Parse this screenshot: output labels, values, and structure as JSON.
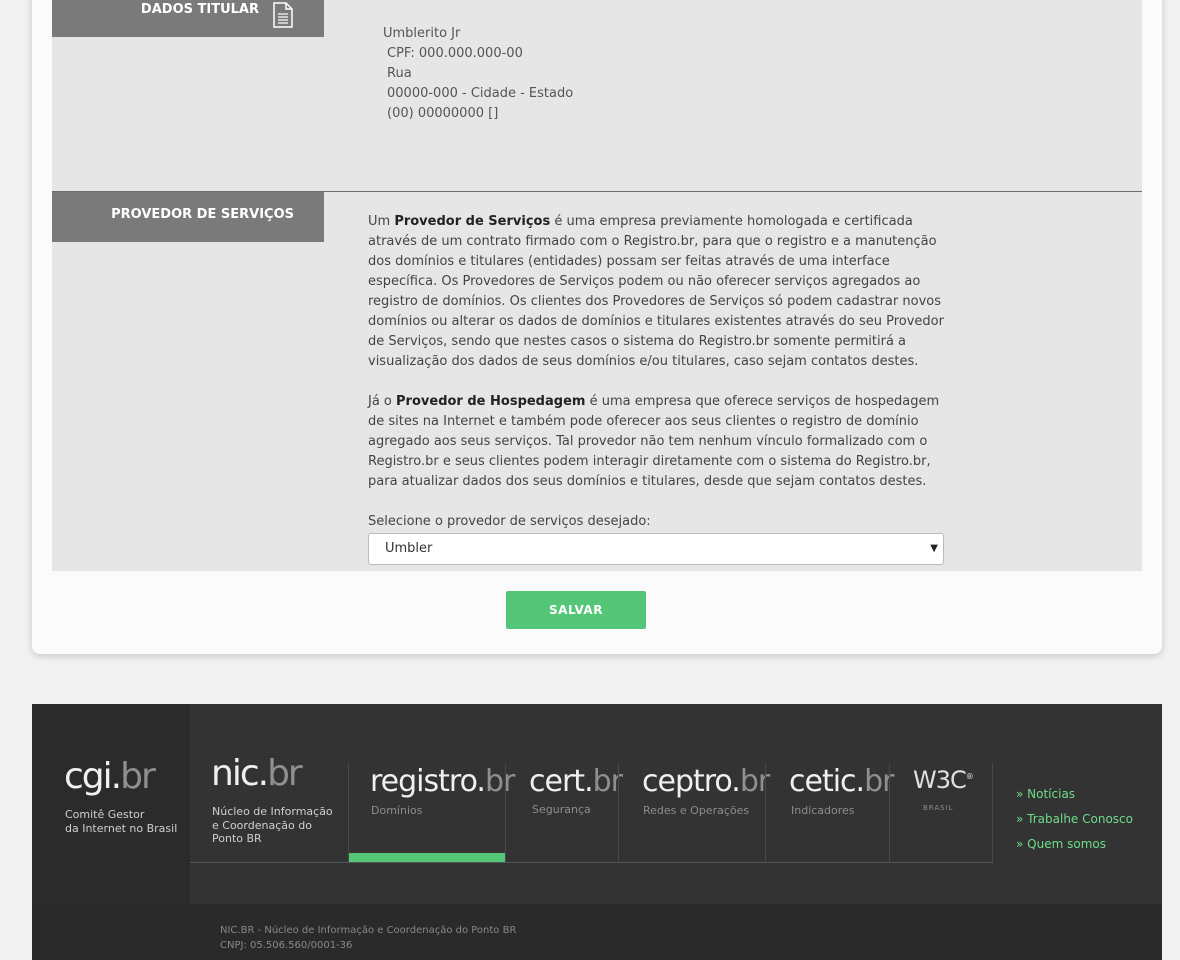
{
  "titular": {
    "label": "DADOS TITULAR",
    "name": "Umblerito Jr",
    "cpf": "CPF: 000.000.000-00",
    "street": "Rua",
    "city": "00000-000 - Cidade - Estado",
    "phone": "(00) 00000000 []"
  },
  "provedor": {
    "label": "PROVEDOR DE SERVIÇOS",
    "p1_pre": "Um ",
    "p1_bold": "Provedor de Serviços",
    "p1_rest": " é uma empresa previamente homologada e certificada através de um contrato firmado com o Registro.br, para que o registro e a manutenção dos domínios e titulares (entidades) possam ser feitas através de uma interface específica. Os Provedores de Serviços podem ou não oferecer serviços agregados ao registro de domínios. Os clientes dos Provedores de Serviços só podem cadastrar novos domínios ou alterar os dados de domínios e titulares existentes através do seu Provedor de Serviços, sendo que nestes casos o sistema do Registro.br somente permitirá a visualização dos dados de seus domínios e/ou titulares, caso sejam contatos destes.",
    "p2_pre": "Já o ",
    "p2_bold": "Provedor de Hospedagem",
    "p2_rest": " é uma empresa que oferece serviços de hospedagem de sites na Internet e também pode oferecer aos seus clientes o registro de domínio agregado aos seus serviços. Tal provedor não tem nenhum vínculo formalizado com o Registro.br e seus clientes podem interagir diretamente com o sistema do Registro.br, para atualizar dados dos seus domínios e titulares, desde que sejam contatos destes.",
    "select_label": "Selecione o provedor de serviços desejado:",
    "select_value": "Umbler"
  },
  "save_label": "SALVAR",
  "footer": {
    "cgi": {
      "name": "cgi",
      "dot": ".",
      "tld": "br",
      "sub1": "Comitê Gestor",
      "sub2": "da Internet no Brasil"
    },
    "nic": {
      "name": "nic",
      "dot": ".",
      "tld": "br",
      "sub1": "Núcleo de Informação",
      "sub2": "e Coordenação do",
      "sub3": "Ponto BR"
    },
    "tiles": [
      {
        "name": "registro",
        "tld": "br",
        "sub": "Domínios"
      },
      {
        "name": "cert",
        "tld": "br",
        "sub": "Segurança"
      },
      {
        "name": "ceptro",
        "tld": "br",
        "sub": "Redes e Operações"
      },
      {
        "name": "cetic",
        "tld": "br",
        "sub": "Indicadores"
      }
    ],
    "w3c": {
      "name": "W3C",
      "reg": "®",
      "sub": "BRASIL"
    },
    "links": [
      "» Notícias",
      "» Trabalhe Conosco",
      "» Quem somos"
    ],
    "bottom1": "NIC.BR - Núcleo de Informação e Coordenação do Ponto BR",
    "bottom2": "CNPJ: 05.506.560/0001-36"
  },
  "colors": {
    "accent": "#55c678",
    "link": "#6edc8a"
  }
}
